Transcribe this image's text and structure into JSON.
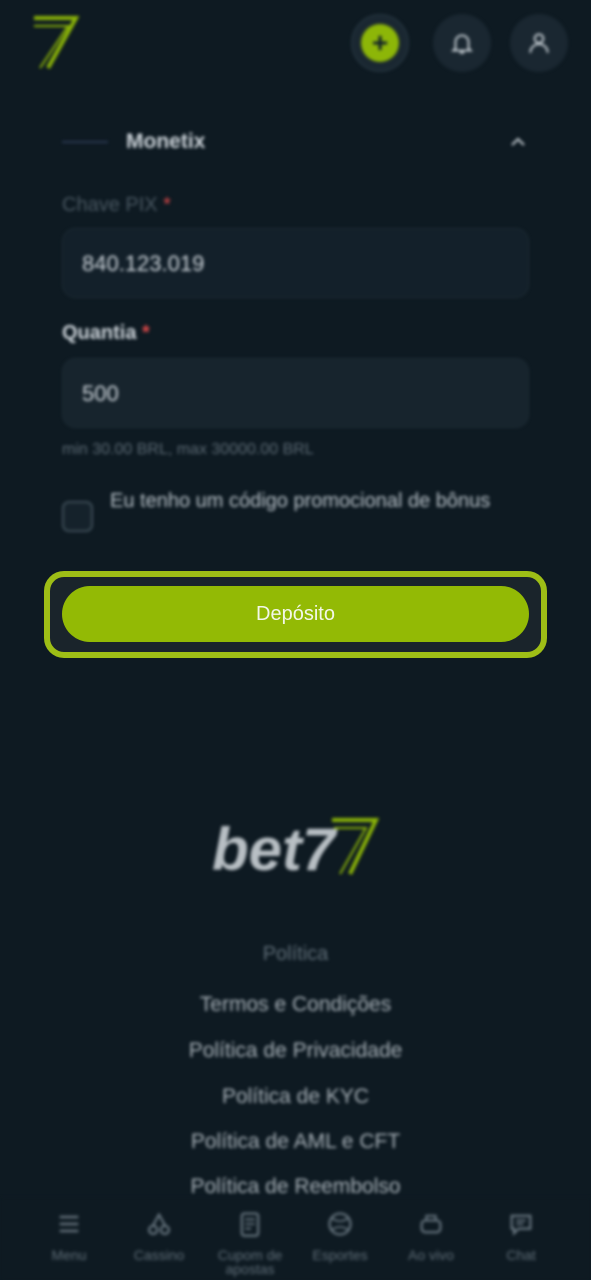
{
  "header": {
    "logo": "bet7-mark-logo",
    "add_icon": "plus-icon",
    "bell_icon": "bell-icon",
    "user_icon": "user-icon"
  },
  "payment": {
    "method_name": "Monetix",
    "pix_label": "Chave PIX",
    "pix_required": "*",
    "pix_value": "840.123.019",
    "amount_label": "Quantia",
    "amount_required": "*",
    "amount_value": "500",
    "hint": "min 30.00 BRL, max 30000.00 BRL",
    "promo_label": "Eu tenho um código promocional de bônus",
    "deposit_button": "Depósito"
  },
  "footer": {
    "brand": "bet7",
    "policy_title": "Política",
    "links": [
      "Termos e Condições",
      "Política de Privacidade",
      "Política de KYC",
      "Política de AML e CFT",
      "Política de Reembolso"
    ]
  },
  "bottom_nav": [
    {
      "label": "Menu",
      "icon": "menu-icon"
    },
    {
      "label": "Cassino",
      "icon": "cherries-icon"
    },
    {
      "label": "Cupom de apostas",
      "icon": "betslip-icon"
    },
    {
      "label": "Esportes",
      "icon": "ball-icon"
    },
    {
      "label": "Ao vivo",
      "icon": "live-icon"
    },
    {
      "label": "Chat",
      "icon": "chat-icon"
    }
  ],
  "colors": {
    "background": "#0e1a22",
    "accent": "#93ba05",
    "highlight_border": "#9ebe16"
  }
}
